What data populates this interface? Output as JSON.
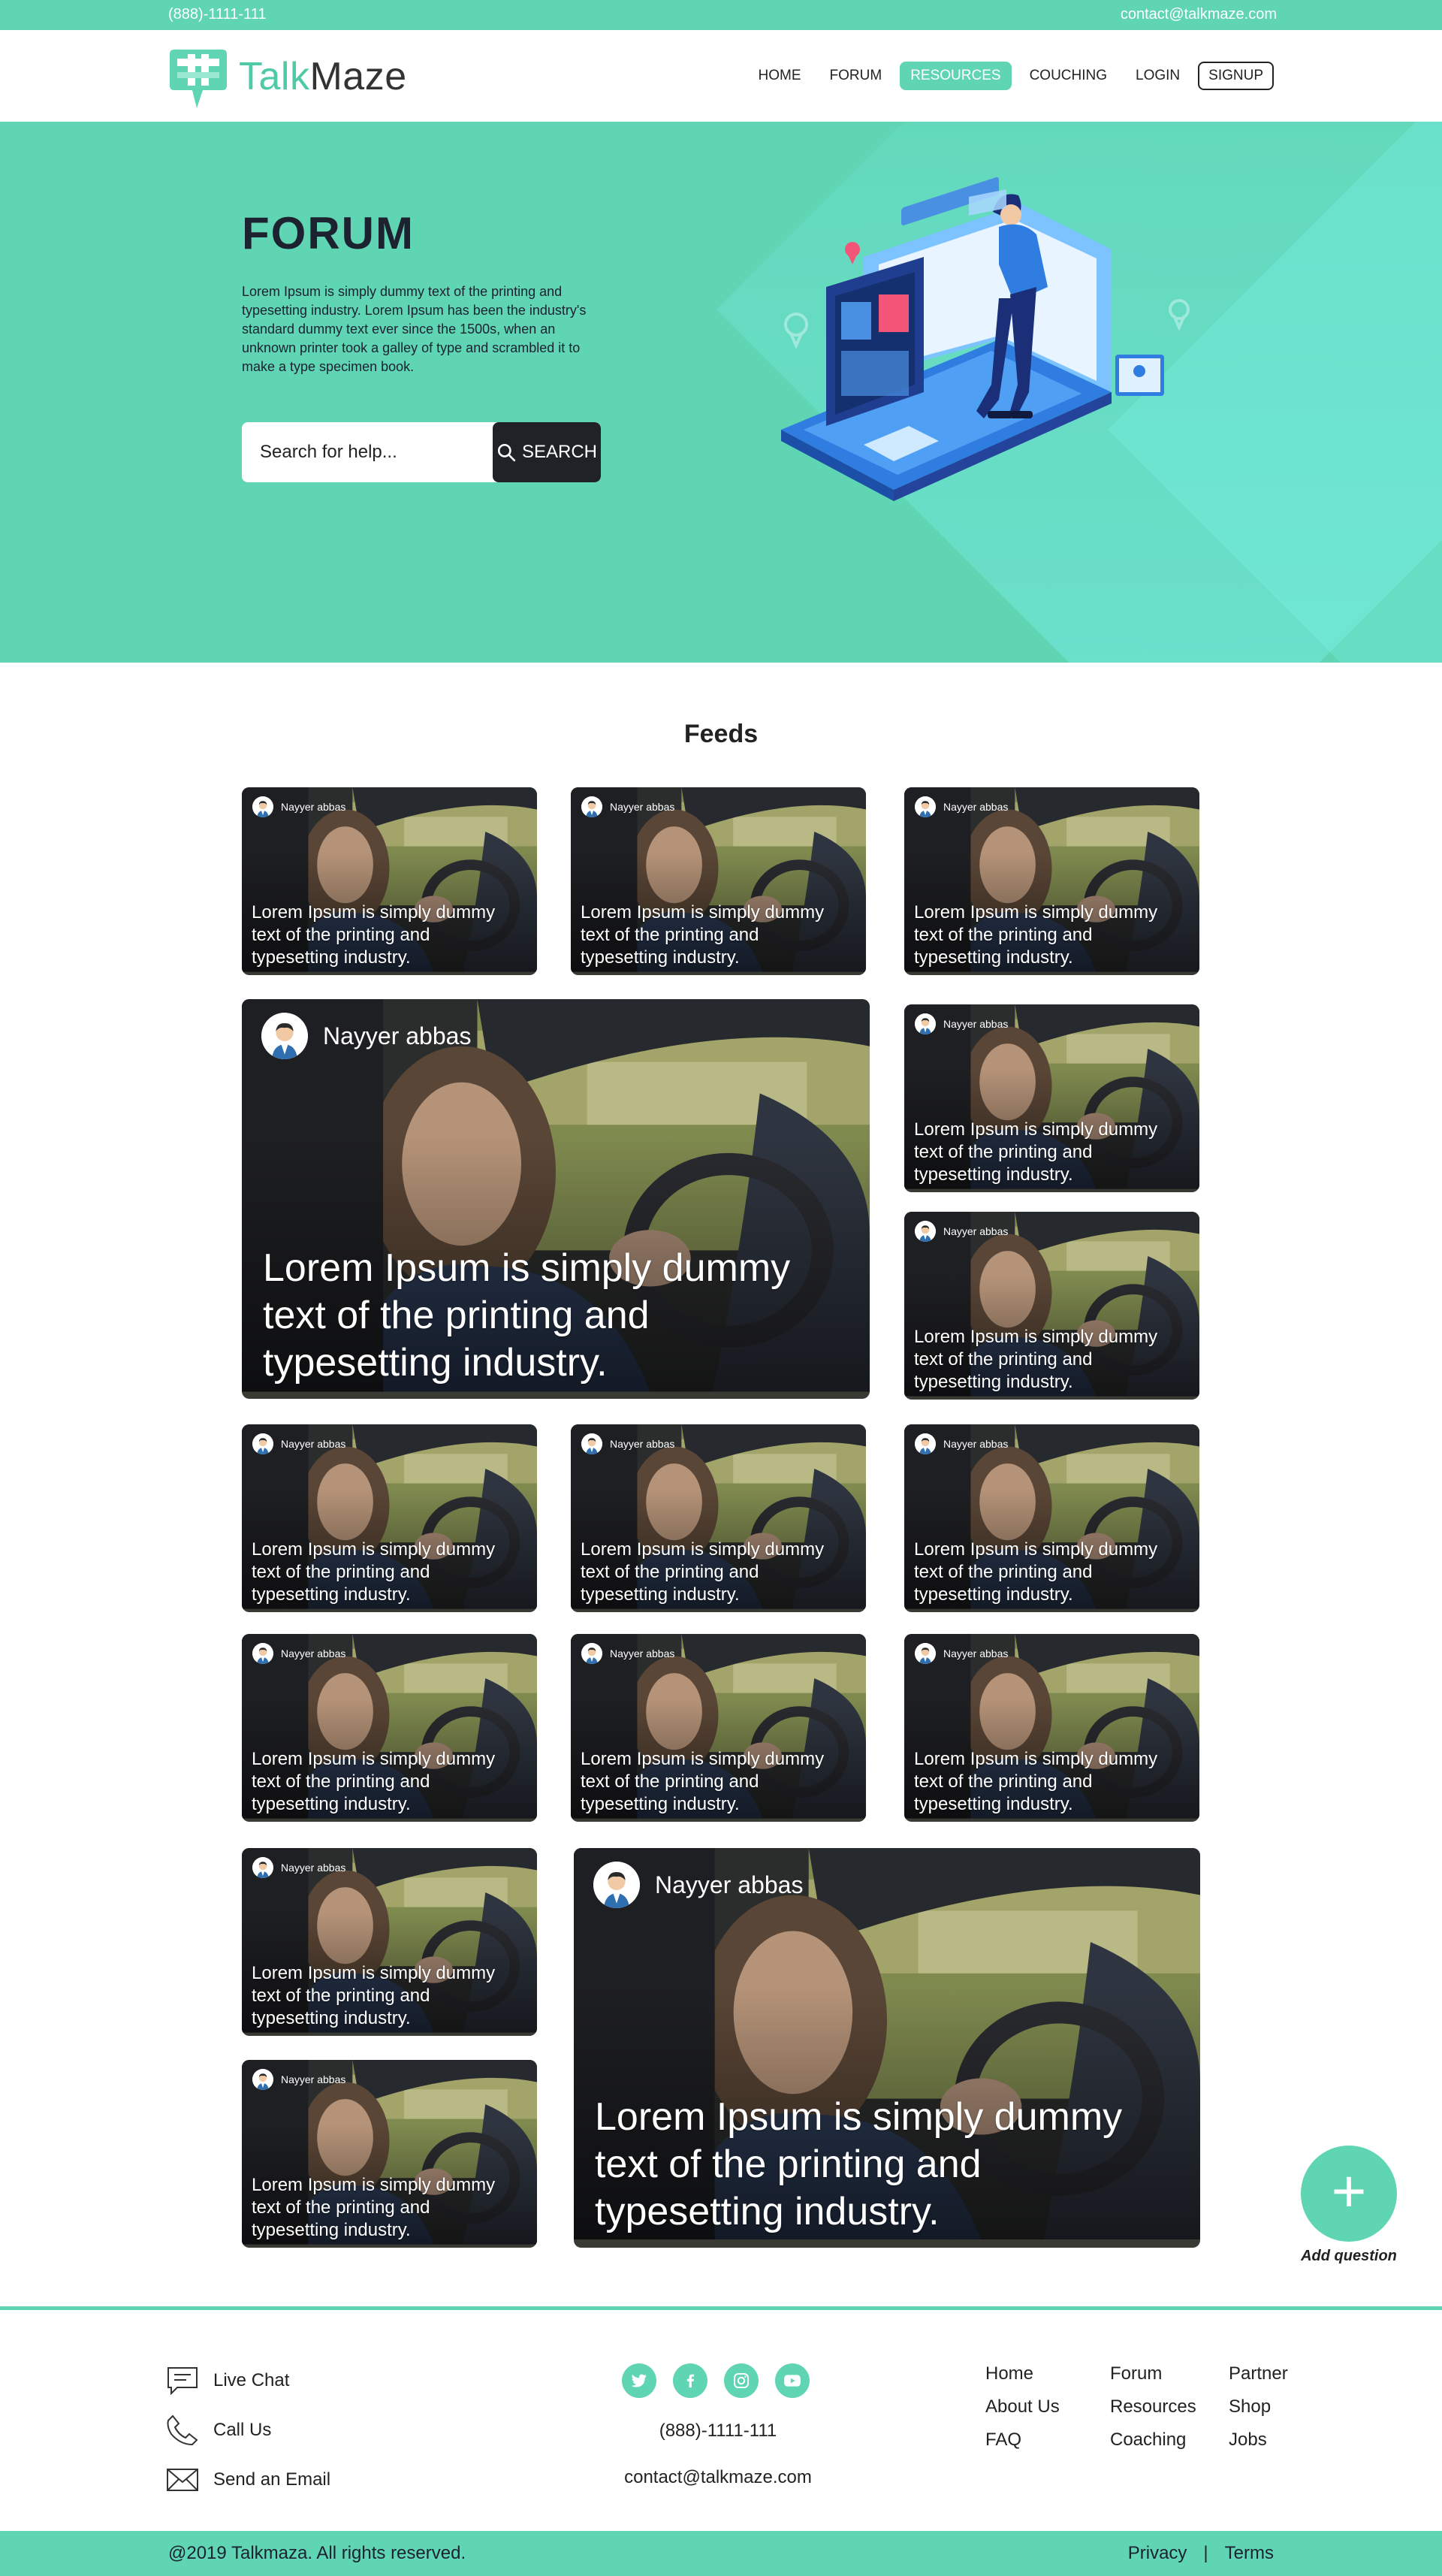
{
  "topbar": {
    "phone": "(888)-1111-111",
    "email": "contact@talkmaze.com"
  },
  "brand": {
    "name_part1": "Talk",
    "name_part2": "Maze",
    "accent": "#5fd5b3"
  },
  "nav": {
    "items": [
      {
        "label": "HOME",
        "state": "default"
      },
      {
        "label": "FORUM",
        "state": "default"
      },
      {
        "label": "RESOURCES",
        "state": "active"
      },
      {
        "label": "COUCHING",
        "state": "default"
      },
      {
        "label": "LOGIN",
        "state": "default"
      },
      {
        "label": "SIGNUP",
        "state": "outlined"
      }
    ]
  },
  "hero": {
    "title": "FORUM",
    "description": "Lorem Ipsum is simply dummy text of the printing and typesetting industry. Lorem Ipsum has been the industry's standard dummy text ever since the 1500s, when an unknown printer took a galley of type and scrambled it to make a type specimen book.",
    "search_placeholder": "Search for help...",
    "search_button": "SEARCH"
  },
  "feeds": {
    "title": "Feeds",
    "author": "Nayyer abbas",
    "caption": "Lorem Ipsum is simply dummy text of the printing and typesetting industry."
  },
  "add_question": {
    "icon": "plus-icon",
    "label": "Add question"
  },
  "footer": {
    "contacts": [
      {
        "icon": "chat-icon",
        "label": "Live Chat"
      },
      {
        "icon": "phone-icon",
        "label": "Call Us"
      },
      {
        "icon": "mail-icon",
        "label": "Send an Email"
      }
    ],
    "social": [
      "twitter-icon",
      "facebook-icon",
      "instagram-icon",
      "youtube-icon"
    ],
    "phone": "(888)-1111-111",
    "email": "contact@talkmaze.com",
    "links_col1": [
      "Home",
      "About Us",
      "FAQ"
    ],
    "links_col2": [
      "Forum",
      "Resources",
      "Coaching"
    ],
    "links_col3": [
      "Partner",
      "Shop",
      "Jobs"
    ]
  },
  "bottom": {
    "copyright": "@2019 Talkmaza. All rights reserved.",
    "privacy": "Privacy",
    "separator": "|",
    "terms": "Terms"
  }
}
